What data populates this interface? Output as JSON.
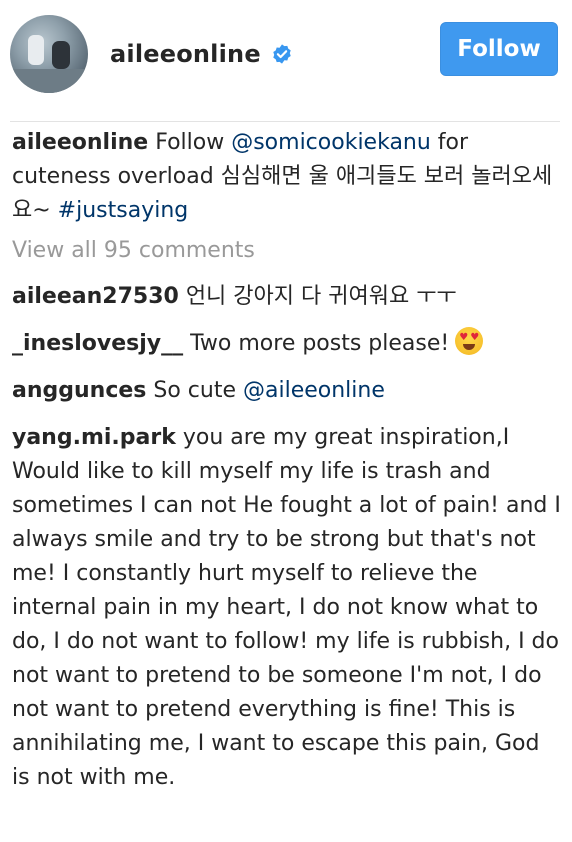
{
  "post": {
    "username": "aileeonline",
    "follow_label": "Follow"
  },
  "caption": {
    "username": "aileeonline",
    "text_before": " Follow ",
    "mention": "@somicookiekanu",
    "text_after": " for cuteness overload 심심해면 울 애긔들도 보러 놀러오세요~ ",
    "hashtag": "#justsaying"
  },
  "view_all_comments": "View all 95 comments",
  "comments": [
    {
      "username": "aileean27530",
      "text": " 언니 강아지 다 귀여워요 ㅜㅜ"
    },
    {
      "username": "_ineslovesjy__",
      "text": " Two more posts please!",
      "emoji": "heart-eyes-emoji"
    },
    {
      "username": "anggunces",
      "text": " So cute ",
      "mention": "@aileeonline"
    },
    {
      "username": "yang.mi.park",
      "text": " you are my great inspiration,I Would like to kill myself my life is trash and sometimes I can not He fought a lot of pain! and I always smile and try to be strong but that's not me! I constantly hurt myself to relieve the internal pain in my heart, I do not know what to do, I do not want to follow! my life is rubbish, I do not want to pretend to be someone I'm not, I do not want to pretend everything is fine! This is annihilating me, I want to escape this pain, God is not with me."
    }
  ],
  "colors": {
    "follow_button": "#3f99ef",
    "link": "#003569",
    "muted": "#999999",
    "verified_badge": "#3897f0"
  }
}
